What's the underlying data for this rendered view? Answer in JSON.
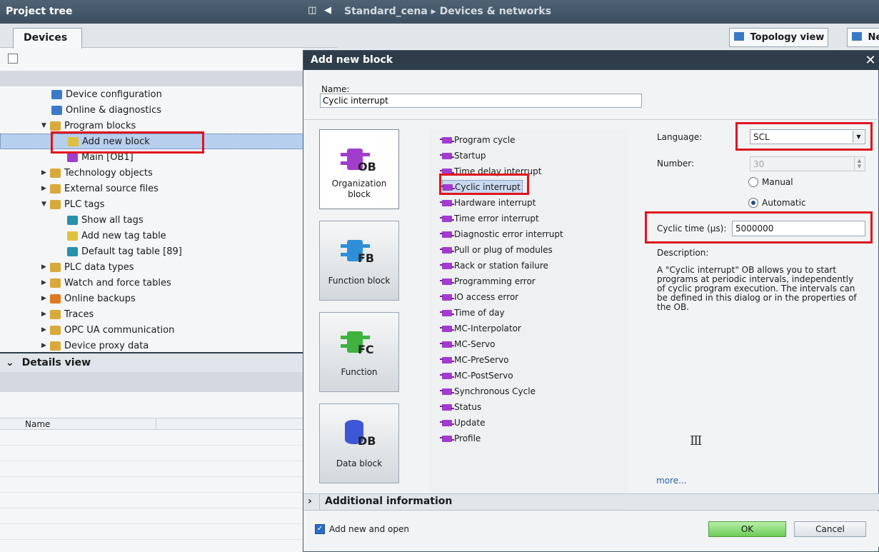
{
  "project_tree": {
    "header_title": "Project tree",
    "header_icons": [
      "split-icon",
      "collapse-left-icon"
    ],
    "tab": "Devices",
    "items": [
      {
        "label": "Device configuration",
        "icon": "device-config-icon"
      },
      {
        "label": "Online & diagnostics",
        "icon": "diagnostics-icon"
      },
      {
        "label": "Program blocks",
        "icon": "folder-icon",
        "expanded": true
      },
      {
        "label": "Add new block",
        "icon": "add-block-icon",
        "selected": true
      },
      {
        "label": "Main [OB1]",
        "icon": "ob-icon"
      },
      {
        "label": "Technology objects",
        "icon": "folder-icon"
      },
      {
        "label": "External source files",
        "icon": "folder-icon"
      },
      {
        "label": "PLC tags",
        "icon": "folder-icon",
        "expanded": true
      },
      {
        "label": "Show all tags",
        "icon": "tags-icon"
      },
      {
        "label": "Add new tag table",
        "icon": "add-icon"
      },
      {
        "label": "Default tag table [89]",
        "icon": "tag-table-icon"
      },
      {
        "label": "PLC data types",
        "icon": "folder-icon"
      },
      {
        "label": "Watch and force tables",
        "icon": "folder-icon"
      },
      {
        "label": "Online backups",
        "icon": "folder-icon"
      },
      {
        "label": "Traces",
        "icon": "folder-icon"
      },
      {
        "label": "OPC UA communication",
        "icon": "folder-icon"
      },
      {
        "label": "Device proxy data",
        "icon": "folder-icon"
      }
    ]
  },
  "details_view": {
    "title": "Details view",
    "column_name": "Name"
  },
  "editor": {
    "breadcrumb": "Standard_cena ▸ Devices & networks",
    "tabs": [
      "Topology view",
      "Ne"
    ]
  },
  "dialog": {
    "title": "Add new block",
    "close": "✕",
    "name_label": "Name:",
    "name_value": "Cyclic interrupt",
    "block_types": [
      {
        "label": "Organization block",
        "tag": "OB",
        "selected": true
      },
      {
        "label": "Function block",
        "tag": "FB"
      },
      {
        "label": "Function",
        "tag": "FC"
      },
      {
        "label": "Data block",
        "tag": "DB"
      }
    ],
    "ob_types": [
      "Program cycle",
      "Startup",
      "Time delay interrupt",
      "Cyclic interrupt",
      "Hardware interrupt",
      "Time error interrupt",
      "Diagnostic error interrupt",
      "Pull or plug of modules",
      "Rack or station failure",
      "Programming error",
      "IO access error",
      "Time of day",
      "MC-Interpolator",
      "MC-Servo",
      "MC-PreServo",
      "MC-PostServo",
      "Synchronous Cycle",
      "Status",
      "Update",
      "Profile"
    ],
    "selected_ob": "Cyclic interrupt",
    "language_label": "Language:",
    "language_value": "SCL",
    "number_label": "Number:",
    "number_value": "30",
    "radio_manual": "Manual",
    "radio_automatic": "Automatic",
    "numbering_mode": "Automatic",
    "cyclic_time_label": "Cyclic time (µs):",
    "cyclic_time_value": "5000000",
    "description_label": "Description:",
    "description_text": "A \"Cyclic interrupt\" OB allows you to start programs at periodic intervals, independently of cyclic program execution. The intervals can be defined in this dialog or in the properties of the OB.",
    "more_link": "more...",
    "additional_info": "Additional information",
    "add_new_open_label": "Add new and open",
    "add_new_open_checked": true,
    "ok": "OK",
    "cancel": "Cancel"
  },
  "colors": {
    "highlight_red": "#e0141e",
    "ob_purple": "#a23ccf",
    "fb_blue": "#2e8fd6",
    "fc_green": "#3fb23f",
    "db_blue": "#3d57d6",
    "ok_green": "#6ccc57"
  }
}
